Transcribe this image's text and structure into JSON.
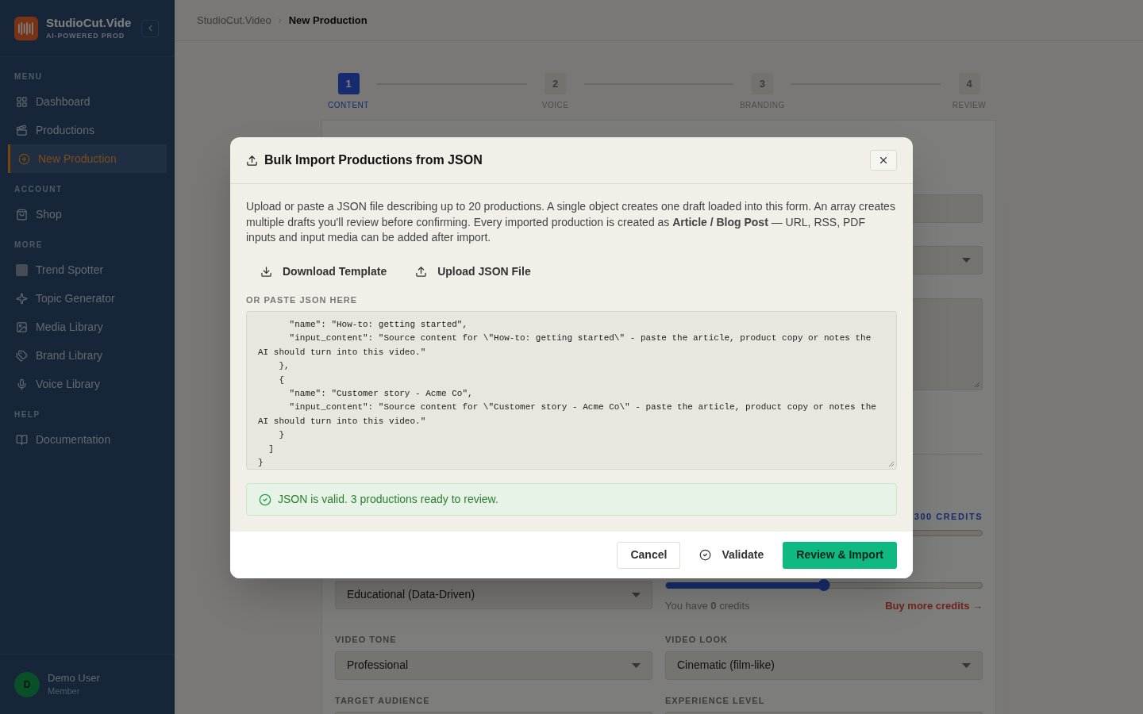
{
  "sidebar": {
    "brand": {
      "name": "StudioCut.Vide",
      "tagline": "AI-POWERED PROD"
    },
    "sections": [
      {
        "title": "MENU",
        "items": [
          {
            "label": "Dashboard",
            "selected": false
          },
          {
            "label": "Productions",
            "selected": false
          },
          {
            "label": "New Production",
            "selected": true
          }
        ]
      },
      {
        "title": "ACCOUNT",
        "items": [
          {
            "label": "Shop",
            "selected": false
          }
        ]
      },
      {
        "title": "MORE",
        "items": [
          {
            "label": "Trend Spotter",
            "selected": false
          },
          {
            "label": "Topic Generator",
            "selected": false
          },
          {
            "label": "Media Library",
            "selected": false
          },
          {
            "label": "Brand Library",
            "selected": false
          },
          {
            "label": "Voice Library",
            "selected": false
          }
        ]
      },
      {
        "title": "HELP",
        "items": [
          {
            "label": "Documentation",
            "selected": false
          }
        ]
      }
    ],
    "user": {
      "initial": "D",
      "name": "Demo User",
      "role": "Member"
    }
  },
  "breadcrumb": [
    {
      "label": "StudioCut.Video",
      "selected": false
    },
    {
      "label": "New Production",
      "selected": true
    }
  ],
  "stepper": [
    {
      "number": "1",
      "label": "CONTENT",
      "selected": true
    },
    {
      "number": "2",
      "label": "VOICE",
      "selected": false
    },
    {
      "number": "3",
      "label": "BRANDING",
      "selected": false
    },
    {
      "number": "4",
      "label": "REVIEW",
      "selected": false
    }
  ],
  "form": {
    "credits_label": "300 CREDITS",
    "style_select": "Educational (Data-Driven)",
    "credits_slider": {
      "level": 0.5
    },
    "balance_text": "You have **0** credits",
    "buy_link": "Buy more credits →",
    "fields": [
      {
        "label": "VIDEO TONE",
        "value": "Professional"
      },
      {
        "label": "VIDEO LOOK",
        "value": "Cinematic (film-like)"
      },
      {
        "label": "TARGET AUDIENCE"
      },
      {
        "label": "EXPERIENCE LEVEL"
      }
    ]
  },
  "dialog": {
    "title": "Bulk Import Productions from JSON",
    "description": "Upload or paste a JSON file describing up to 20 productions. A single object creates one draft loaded into this form. An array creates multiple drafts you'll review before confirming. Every imported production is created as **Article / Blog Post** — URL, RSS, PDF inputs and input media can be added after import.",
    "actions": [
      {
        "label": "Download Template"
      },
      {
        "label": "Upload JSON File"
      }
    ],
    "paste_label": "OR PASTE JSON HERE",
    "code_lines": [
      "      \"name\": \"How-to: getting started\",",
      "      \"input_content\": \"Source content for \\\"How-to: getting started\\\" - paste the article, product copy or notes the",
      "AI should turn into this video.\"",
      "    },",
      "    {",
      "      \"name\": \"Customer story - Acme Co\",",
      "      \"input_content\": \"Source content for \\\"Customer story - Acme Co\\\" - paste the article, product copy or notes the",
      "AI should turn into this video.\"",
      "    }",
      "  ]",
      "}"
    ],
    "status": {
      "kind": "success",
      "text": "JSON is valid. 3 productions ready to review."
    },
    "buttons": [
      {
        "label": "Cancel",
        "kind": "secondary"
      },
      {
        "label": "Validate",
        "kind": "ghost"
      },
      {
        "label": "Review & Import",
        "kind": "primary"
      }
    ]
  }
}
